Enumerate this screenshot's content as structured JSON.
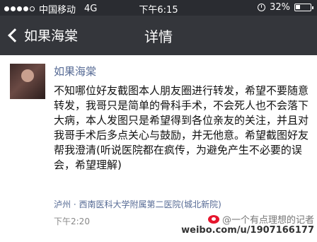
{
  "status_bar": {
    "carrier": "中国移动",
    "network": "4G",
    "time": "下午6:15",
    "battery": "32%"
  },
  "nav": {
    "back_label": "如果海棠",
    "title": "详情"
  },
  "post": {
    "author": "如果海棠",
    "text": "不知哪位好友截图本人朋友圈进行转发，希望不要随意转发，我哥只是简单的骨科手术，不会死人也不会落下大病，本人发图只是希望得到各位亲友的关注，并且对我哥手术后多点关心与鼓励，并无他意。希望截图好友帮我澄清(听说医院都在疯传，为避免产生不必要的误会，希望理解)",
    "location": "泸州 · 西南医科大学附属第二医院(城北新院)",
    "time": "下午2:20"
  },
  "watermark": {
    "label": "@一个有点理想的记者",
    "url": "weibo.com/u/1907166177"
  },
  "colors": {
    "status_bg": "#2a2c31",
    "nav_bg": "#34363b",
    "link": "#576b95"
  }
}
